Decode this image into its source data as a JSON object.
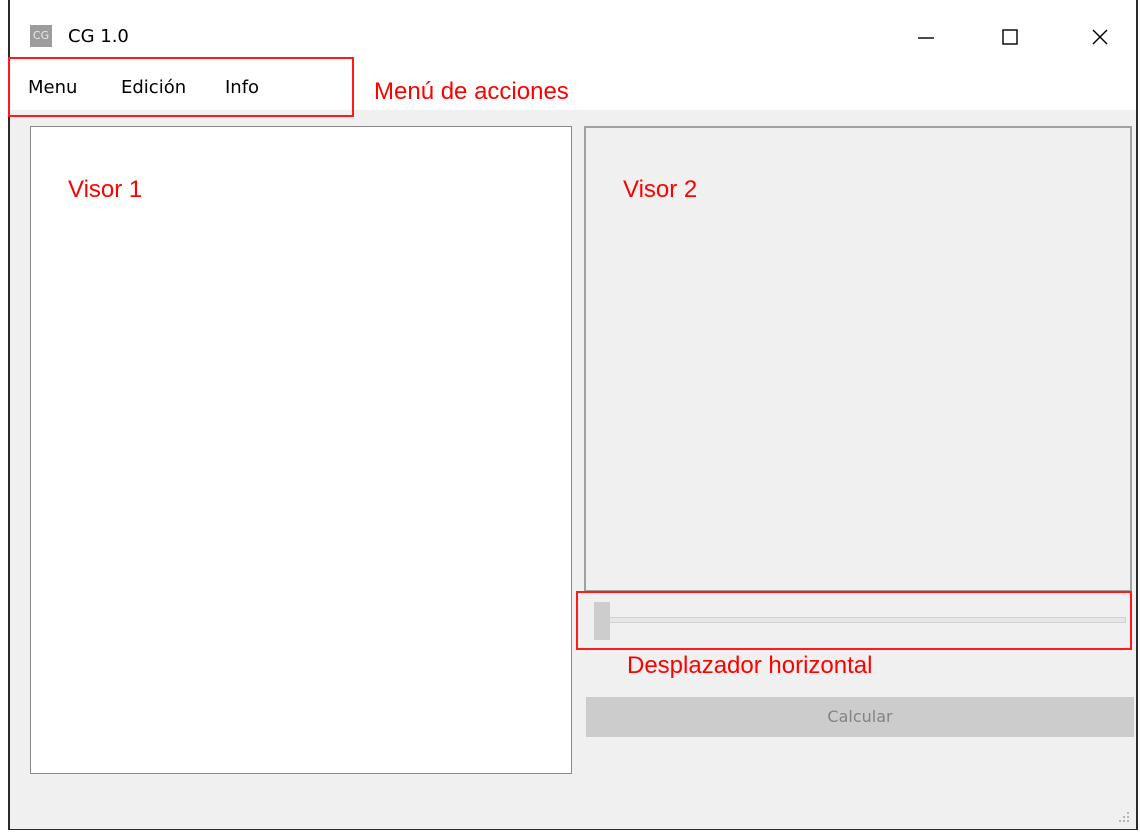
{
  "window": {
    "app_icon_text": "CG",
    "title": "CG 1.0",
    "controls": {
      "minimize_icon": "minimize-icon",
      "maximize_icon": "maximize-icon",
      "close_icon": "close-icon"
    }
  },
  "menubar": {
    "items": [
      {
        "label": "Menu"
      },
      {
        "label": "Edición"
      },
      {
        "label": "Info"
      }
    ]
  },
  "annotations": {
    "menu": "Menú de acciones",
    "visor1": "Visor 1",
    "visor2": "Visor 2",
    "slider": "Desplazador horizontal",
    "color": "#ff0000"
  },
  "slider": {
    "value_fraction": 0.0
  },
  "actions": {
    "calculate_label": "Calcular",
    "calculate_enabled": false
  }
}
